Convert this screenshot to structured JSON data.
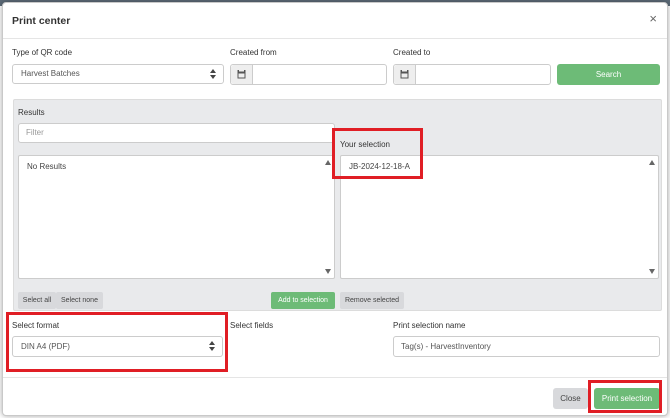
{
  "modal": {
    "title": "Print center",
    "close_glyph": "×"
  },
  "qr_type": {
    "label": "Type of QR code",
    "value": "Harvest Batches"
  },
  "created_from": {
    "label": "Created from",
    "value": ""
  },
  "created_to": {
    "label": "Created to",
    "value": ""
  },
  "search_button": "Search",
  "results": {
    "label": "Results",
    "filter_placeholder": "Filter",
    "empty_text": "No Results"
  },
  "selection": {
    "label": "Your selection",
    "items": [
      "JB-2024-12-18-A"
    ]
  },
  "buttons": {
    "select_all": "Select all",
    "select_none": "Select none",
    "add_to_selection": "Add to selection",
    "remove_selected": "Remove selected",
    "close": "Close",
    "print_selection": "Print selection"
  },
  "format": {
    "label": "Select format",
    "value": "DIN A4 (PDF)"
  },
  "fields": {
    "label": "Select fields"
  },
  "print_name": {
    "label": "Print selection name",
    "value": "Tag(s) - HarvestInventory"
  },
  "colors": {
    "accent_green": "#6dbb77",
    "highlight_red": "#e01e25"
  },
  "icons": {
    "calendar": "calendar-icon",
    "caret": "sort-caret-icon",
    "close": "close-icon"
  }
}
